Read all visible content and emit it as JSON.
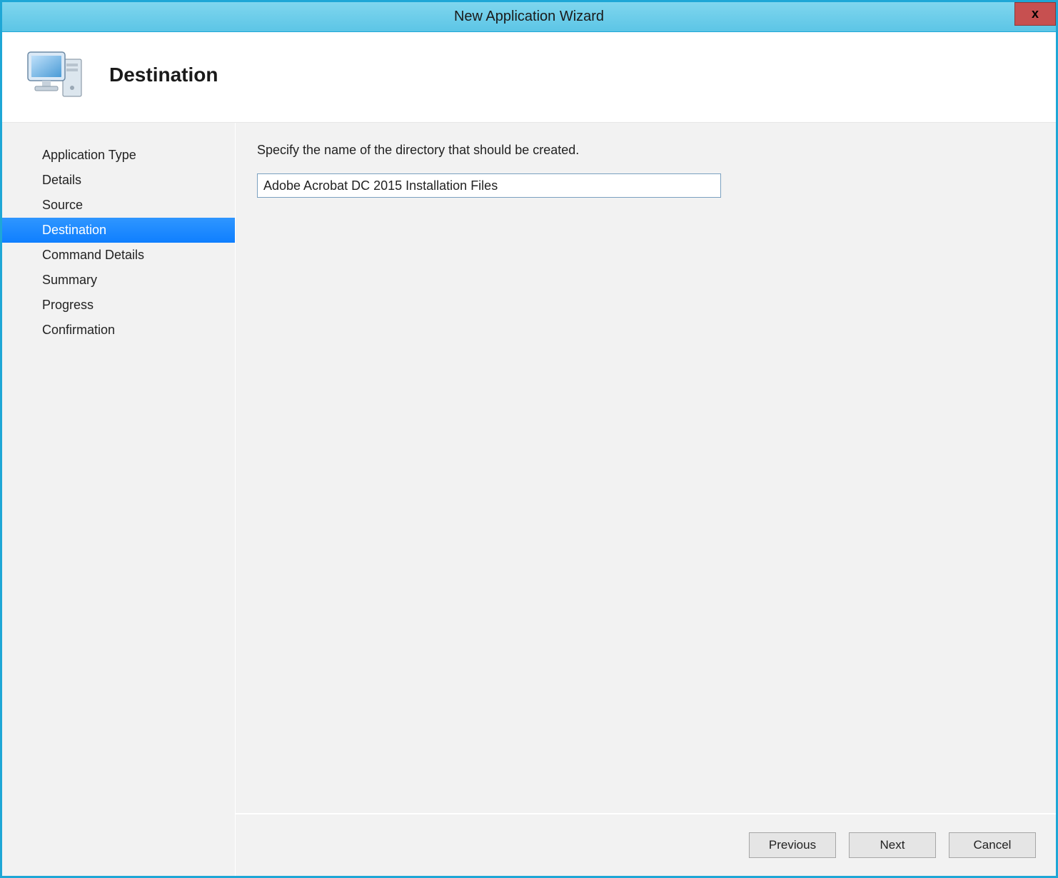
{
  "window": {
    "title": "New Application Wizard",
    "close_label": "x"
  },
  "header": {
    "page_title": "Destination",
    "icon": "computer-icon"
  },
  "sidebar": {
    "items": [
      {
        "label": "Application Type",
        "selected": false
      },
      {
        "label": "Details",
        "selected": false
      },
      {
        "label": "Source",
        "selected": false
      },
      {
        "label": "Destination",
        "selected": true
      },
      {
        "label": "Command Details",
        "selected": false
      },
      {
        "label": "Summary",
        "selected": false
      },
      {
        "label": "Progress",
        "selected": false
      },
      {
        "label": "Confirmation",
        "selected": false
      }
    ]
  },
  "content": {
    "instruction": "Specify the name of the directory that should be created.",
    "directory_value": "Adobe Acrobat DC 2015 Installation Files"
  },
  "footer": {
    "previous_label": "Previous",
    "next_label": "Next",
    "cancel_label": "Cancel"
  }
}
